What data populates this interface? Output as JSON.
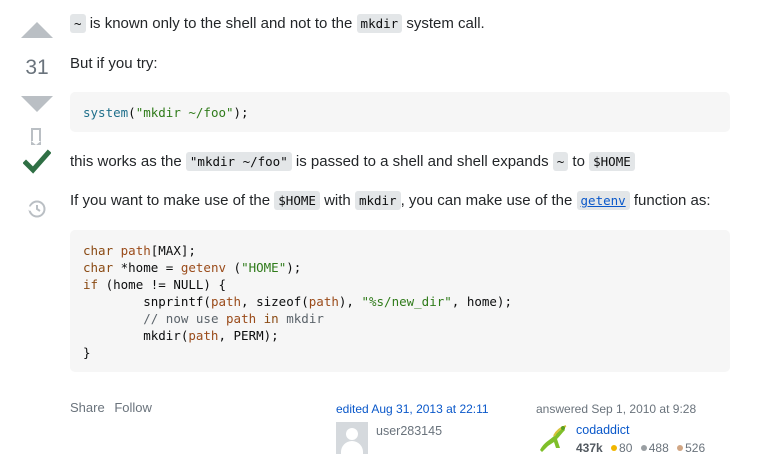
{
  "vote": {
    "count": "31"
  },
  "content": {
    "p1_suffix_a": " is known only to the shell and not to the ",
    "p1_code_tilde": "~",
    "p1_code_mkdir": "mkdir",
    "p1_suffix_b": " system call.",
    "p2": "But if you try:",
    "code1": "system(\"mkdir ~/foo\");",
    "p3_a": "this works as the ",
    "p3_code1": "\"mkdir ~/foo\"",
    "p3_b": " is passed to a shell and shell expands ",
    "p3_code2": "~",
    "p3_c": " to ",
    "p3_code3": "$HOME",
    "p4_a": "If you want to make use of the ",
    "p4_code1": "$HOME",
    "p4_b": " with ",
    "p4_code2": "mkdir",
    "p4_c": ", you can make use of the ",
    "p4_link": "getenv",
    "p4_d": " function as:"
  },
  "footer": {
    "share": "Share",
    "follow": "Follow"
  },
  "edited": {
    "label": "edited Aug 31, 2013 at 22:11",
    "user": "user283145"
  },
  "answered": {
    "label": "answered Sep 1, 2010 at 9:28",
    "user": "codaddict",
    "reputation": "437k",
    "gold": "80",
    "silver": "488",
    "bronze": "526",
    "gold_color": "#f1b600",
    "silver_color": "#9a9fa3",
    "bronze_color": "#d1a684"
  },
  "colors": {
    "accepted": "#2f6f44",
    "link": "#0a58ca"
  }
}
